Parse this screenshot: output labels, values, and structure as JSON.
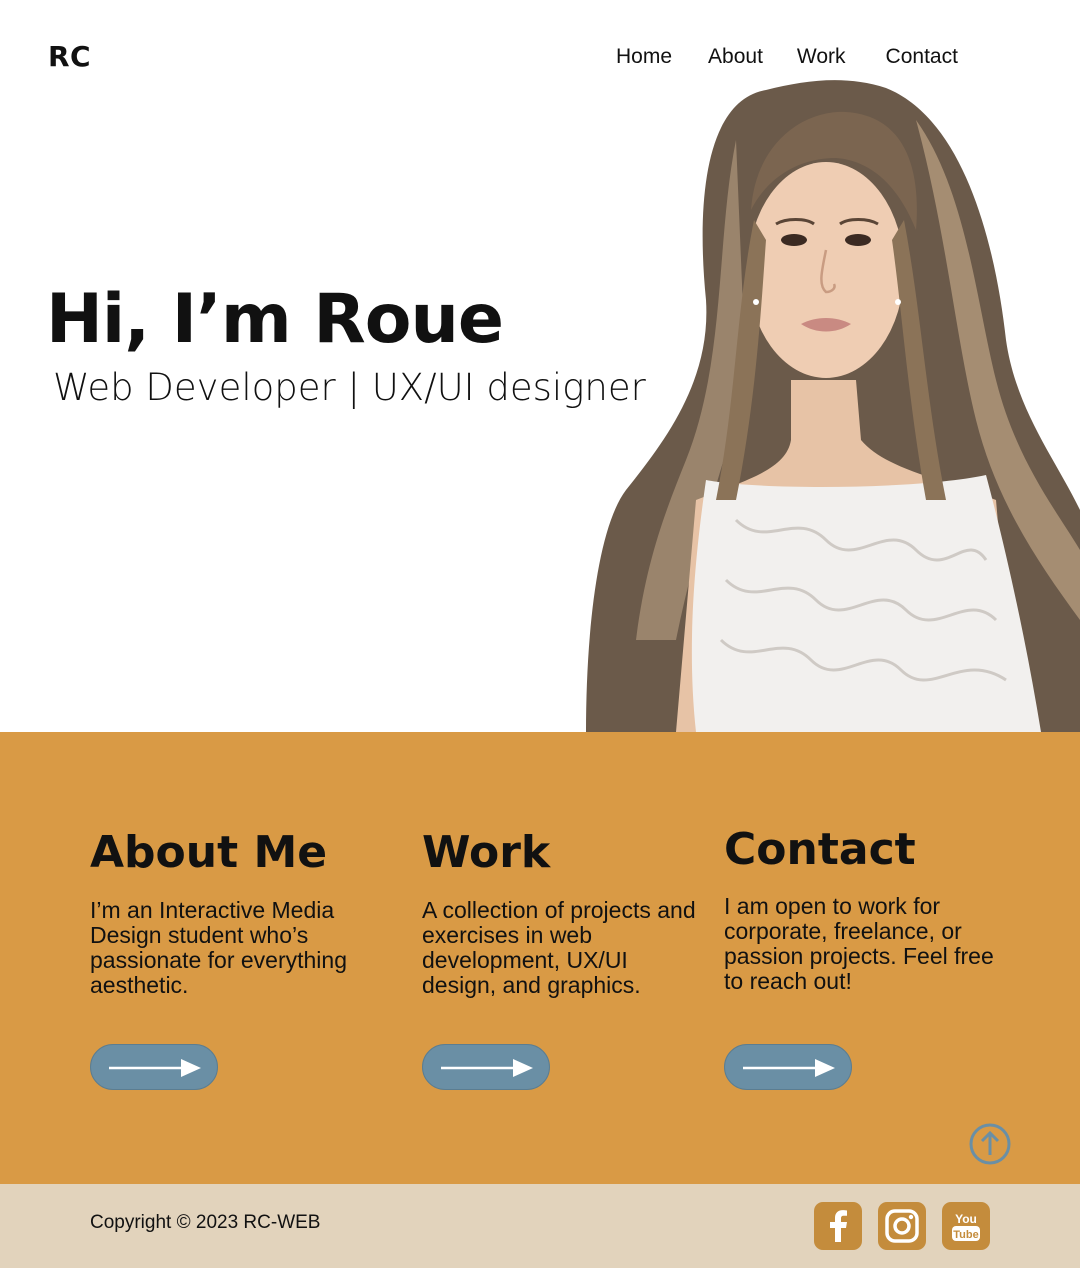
{
  "header": {
    "logo": "RC",
    "nav": [
      "Home",
      "About",
      "Work",
      "Contact"
    ]
  },
  "hero": {
    "title": "Hi, I’m Roue",
    "subtitle": "Web Developer | UX/UI designer"
  },
  "sections": [
    {
      "heading": "About Me",
      "text": "I’m an Interactive Media Design student who’s passionate for everything aesthetic."
    },
    {
      "heading": "Work",
      "text": "A collection of projects and exercises in web development, UX/UI design, and graphics."
    },
    {
      "heading": "Contact",
      "text": "I am open to work for corporate, freelance, or passion projects. Feel free to reach out!"
    }
  ],
  "footer": {
    "copyright": "Copyright © 2023 RC-WEB",
    "social": [
      "facebook-icon",
      "instagram-icon",
      "youtube-icon"
    ],
    "youtube_label_top": "You",
    "youtube_label_bottom": "Tube"
  },
  "colors": {
    "accent_orange": "#d99a45",
    "button_blue": "#6a8fa5",
    "footer_beige": "#e2d3bc",
    "social_brown": "#c48c3c"
  },
  "icons": {
    "arrow": "arrow-right-icon",
    "back_to_top": "arrow-up-circle-icon"
  }
}
